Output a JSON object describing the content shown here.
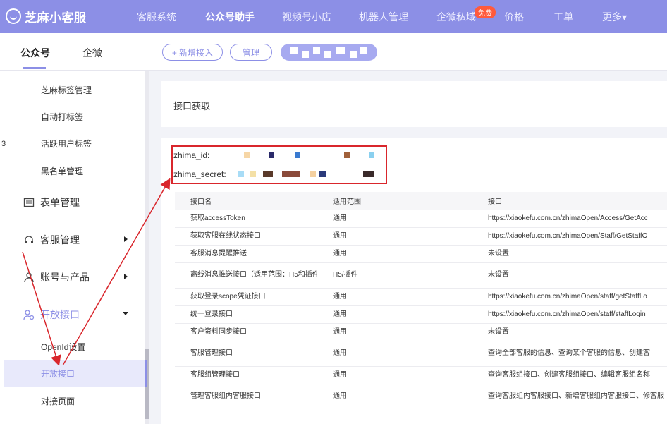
{
  "header": {
    "brand": "芝麻小客服",
    "nav": [
      {
        "label": "客服系统",
        "active": false
      },
      {
        "label": "公众号助手",
        "active": true
      },
      {
        "label": "视频号小店",
        "active": false
      },
      {
        "label": "机器人管理",
        "active": false
      },
      {
        "label": "企微私域",
        "active": false
      },
      {
        "label": "价格",
        "active": false
      },
      {
        "label": "工单",
        "active": false
      },
      {
        "label": "更多▾",
        "active": false
      }
    ],
    "badge": "免费"
  },
  "subnav": {
    "tabs": [
      {
        "label": "公众号"
      },
      {
        "label": "企微"
      }
    ],
    "add_button": "+ 新增接入",
    "manage_button": "管理"
  },
  "sidebar": {
    "items": [
      {
        "label": "芝麻标签管理"
      },
      {
        "label": "自动打标签"
      },
      {
        "label": "活跃用户标签"
      },
      {
        "label": "黑名单管理"
      }
    ],
    "groups": [
      {
        "label": "表单管理"
      },
      {
        "label": "客服管理"
      },
      {
        "label": "账号与产品"
      },
      {
        "label": "开放接口"
      }
    ],
    "sub_items": [
      {
        "label": "OpenId设置"
      },
      {
        "label": "开放接口"
      },
      {
        "label": "对接页面"
      }
    ],
    "left_edge_glyph": "3"
  },
  "main": {
    "section_title": "接口获取",
    "credentials": [
      {
        "label": "zhima_id:"
      },
      {
        "label": "zhima_secret:"
      }
    ],
    "table": {
      "headers": [
        "接口名",
        "适用范围",
        "接口"
      ],
      "rows": [
        [
          "获取accessToken",
          "通用",
          "https://xiaokefu.com.cn/zhimaOpen/Access/GetAcc"
        ],
        [
          "获取客服在线状态接口",
          "通用",
          "https://xiaokefu.com.cn/zhimaOpen/Staff/GetStaffO"
        ],
        [
          "客服消息提醒推送",
          "通用",
          "未设置"
        ],
        [
          "离线消息推送接口（适用范围：H5和插件",
          "H5/插件",
          "未设置"
        ],
        [
          "获取登录scope凭证接口",
          "通用",
          "https://xiaokefu.com.cn/zhimaOpen/staff/getStaffLo"
        ],
        [
          "统一登录接口",
          "通用",
          "https://xiaokefu.com.cn/zhimaOpen/staff/staffLogin"
        ],
        [
          "客户资料同步接口",
          "通用",
          "未设置"
        ],
        [
          "客服管理接口",
          "通用",
          "查询全部客服的信息、查询某个客服的信息、创建客"
        ],
        [
          "客服组管理接口",
          "通用",
          "查询客服组接口、创建客服组接口、编辑客服组名称"
        ],
        [
          "管理客服组内客服接口",
          "通用",
          "查询客服组内客服接口、新增客服组内客服接口、修客服"
        ]
      ]
    }
  },
  "colors": {
    "brand": "#8c8fe6",
    "highlight": "#d9262c",
    "selected_bg": "#e8e9fb"
  }
}
